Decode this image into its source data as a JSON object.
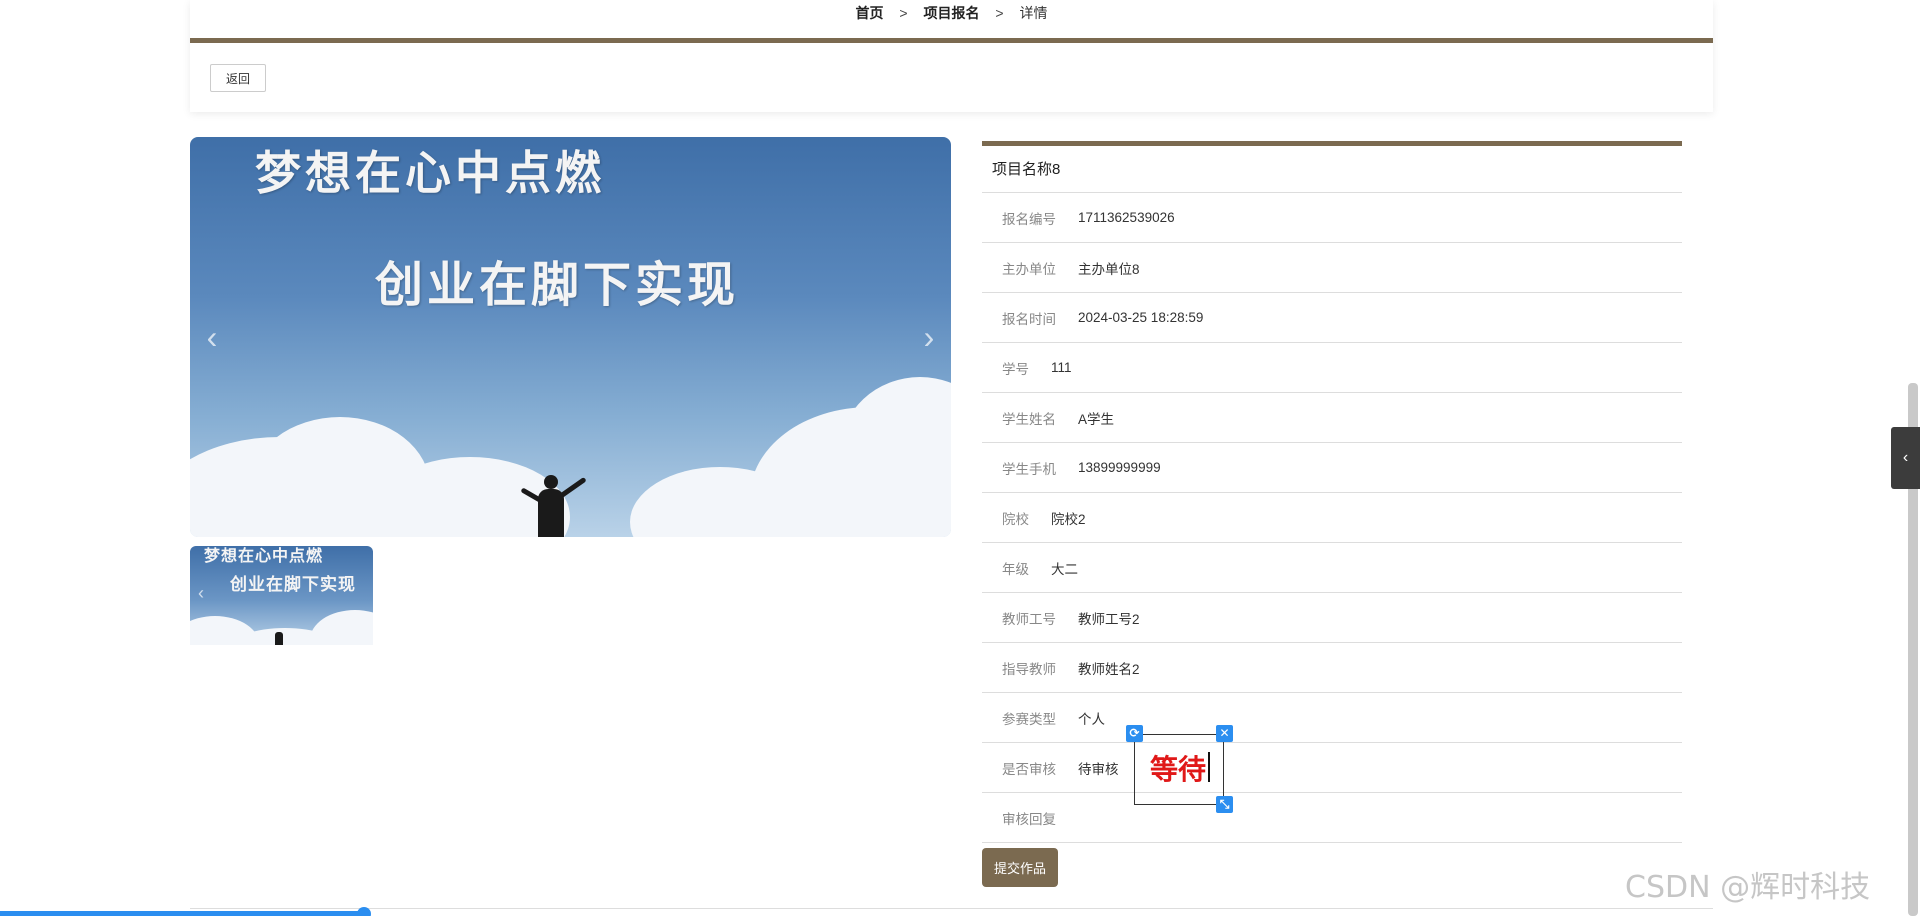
{
  "breadcrumb": {
    "home": "首页",
    "sep1": ">",
    "section": "项目报名",
    "sep2": ">",
    "current": "详情"
  },
  "toolbar": {
    "back_label": "返回"
  },
  "carousel": {
    "slogan_line1": "梦想在心中点燃",
    "slogan_line2": "创业在脚下实现",
    "prev_icon": "‹",
    "next_icon": "›"
  },
  "thumbnail": {
    "line1": "梦想在心中点燃",
    "line2": "创业在脚下实现"
  },
  "detail": {
    "title": "项目名称8",
    "rows": [
      {
        "label": "报名编号",
        "value": "1711362539026"
      },
      {
        "label": "主办单位",
        "value": "主办单位8"
      },
      {
        "label": "报名时间",
        "value": "2024-03-25 18:28:59"
      },
      {
        "label": "学号",
        "value": "111"
      },
      {
        "label": "学生姓名",
        "value": "A学生"
      },
      {
        "label": "学生手机",
        "value": "13899999999"
      },
      {
        "label": "院校",
        "value": "院校2"
      },
      {
        "label": "年级",
        "value": "大二"
      },
      {
        "label": "教师工号",
        "value": "教师工号2"
      },
      {
        "label": "指导教师",
        "value": "教师姓名2"
      },
      {
        "label": "参赛类型",
        "value": "个人"
      },
      {
        "label": "是否审核",
        "value": "待审核"
      },
      {
        "label": "审核回复",
        "value": ""
      }
    ],
    "submit_label": "提交作品"
  },
  "widget": {
    "text": "等待",
    "rotate_icon": "⟳",
    "close_icon": "✕",
    "resize_icon": "⤡"
  },
  "side_toggle_icon": "‹",
  "watermark": "CSDN @辉时科技",
  "colors": {
    "accent": "#7b6a50",
    "widget_blue": "#2b8ef0",
    "widget_text": "#e01818"
  }
}
